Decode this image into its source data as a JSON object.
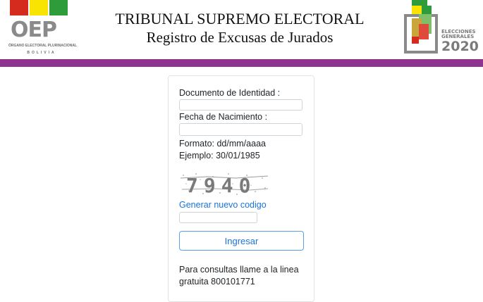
{
  "header": {
    "logo": {
      "text": "OEP",
      "subtitle": "ÓRGANO ELECTORAL PLURINACIONAL",
      "country": "BOLIVIA",
      "flag_colors": [
        "#d52b1e",
        "#f9e300",
        "#007934"
      ]
    },
    "title": "TRIBUNAL SUPREMO ELECTORAL",
    "subtitle": "Registro de Excusas de Jurados",
    "election_logo": {
      "line1": "ELECCIONES",
      "line2": "GENERALES",
      "year": "2020"
    },
    "bar_color": "#8e338f"
  },
  "form": {
    "documento_label": "Documento de Identidad :",
    "documento_value": "",
    "fecha_label": "Fecha de Nacimiento :",
    "fecha_value": "",
    "formato_text": "Formato: dd/mm/aaaa",
    "ejemplo_text": "Ejemplo: 30/01/1985",
    "captcha_code": "7940",
    "regenerate_link": "Generar nuevo codigo",
    "captcha_value": "",
    "submit_label": "Ingresar",
    "info_text": "Para consultas llame a la linea gratuita 800101771",
    "accent_color": "#1a73d8"
  }
}
